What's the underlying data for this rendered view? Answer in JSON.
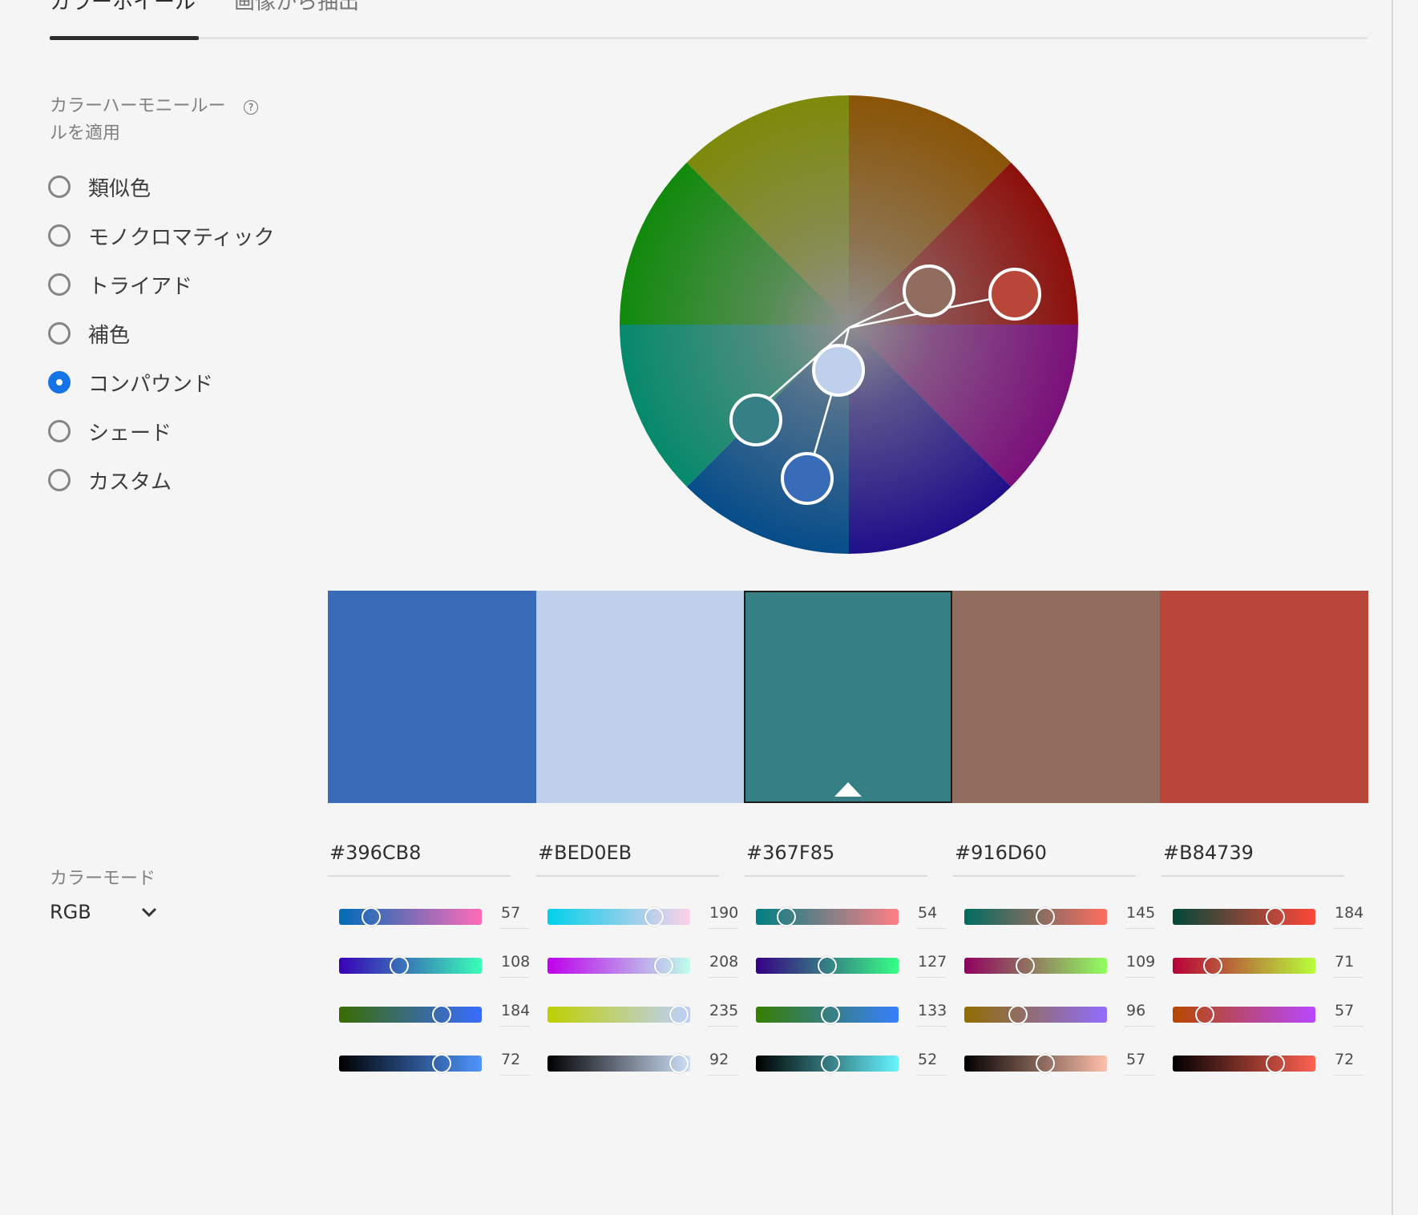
{
  "tabs": [
    {
      "label": "カラーホイール",
      "active": true
    },
    {
      "label": "画像から抽出",
      "active": false
    }
  ],
  "harmony": {
    "label": "カラーハーモニールールを適用",
    "help_icon": "question-circle-icon",
    "options": [
      {
        "label": "類似色",
        "checked": false
      },
      {
        "label": "モノクロマティック",
        "checked": false
      },
      {
        "label": "トライアド",
        "checked": false
      },
      {
        "label": "補色",
        "checked": false
      },
      {
        "label": "コンパウンド",
        "checked": true
      },
      {
        "label": "シェード",
        "checked": false
      },
      {
        "label": "カスタム",
        "checked": false
      }
    ]
  },
  "swatches": [
    {
      "hex": "#396CB8",
      "selected": false
    },
    {
      "hex": "#BED0EB",
      "selected": false
    },
    {
      "hex": "#367F85",
      "selected": true
    },
    {
      "hex": "#916D60",
      "selected": false
    },
    {
      "hex": "#B84739",
      "selected": false
    }
  ],
  "color_mode": {
    "label": "カラーモード",
    "value": "RGB",
    "icon": "chevron-down-icon"
  },
  "channels": [
    {
      "hex": "#396CB8",
      "values": [
        "57",
        "108",
        "184",
        "72"
      ]
    },
    {
      "hex": "#BED0EB",
      "values": [
        "190",
        "208",
        "235",
        "92"
      ]
    },
    {
      "hex": "#367F85",
      "values": [
        "54",
        "127",
        "133",
        "52"
      ]
    },
    {
      "hex": "#916D60",
      "values": [
        "145",
        "109",
        "96",
        "57"
      ]
    },
    {
      "hex": "#B84739",
      "values": [
        "184",
        "71",
        "57",
        "72"
      ]
    }
  ]
}
